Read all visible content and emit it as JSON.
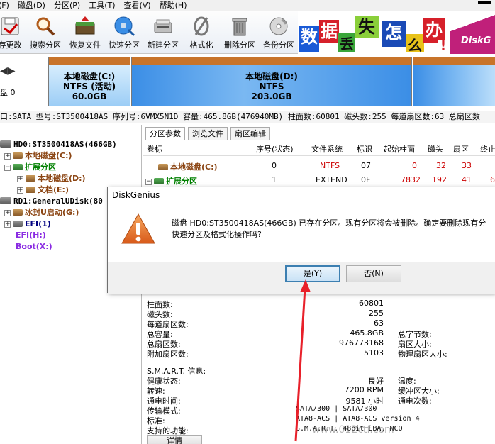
{
  "menu": {
    "items": [
      "(F)",
      "磁盘(D)",
      "分区(P)",
      "工具(T)",
      "查看(V)",
      "帮助(H)"
    ]
  },
  "toolbar": {
    "buttons": [
      {
        "label": "存更改",
        "icon": "save-icon"
      },
      {
        "label": "搜索分区",
        "icon": "magnifier-icon"
      },
      {
        "label": "恢复文件",
        "icon": "recover-files-icon"
      },
      {
        "label": "快速分区",
        "icon": "quick-partition-icon"
      },
      {
        "label": "新建分区",
        "icon": "new-partition-icon"
      },
      {
        "label": "格式化",
        "icon": "format-icon"
      },
      {
        "label": "删除分区",
        "icon": "trash-icon"
      },
      {
        "label": "备份分区",
        "icon": "backup-cd-icon"
      }
    ]
  },
  "banner": {
    "chars": [
      "数",
      "据",
      "丢",
      "失",
      "怎",
      "么",
      "办",
      "!"
    ],
    "brand": "DiskG"
  },
  "diskmap": {
    "left_label": "盘  0",
    "partitions": [
      {
        "name": "本地磁盘(C:)",
        "fs": "NTFS (活动)",
        "size": "60.0GB"
      },
      {
        "name": "本地磁盘(D:)",
        "fs": "NTFS",
        "size": "203.0GB"
      }
    ],
    "info": "口:SATA  型号:ST3500418AS  序列号:6VMX5N1D  容量:465.8GB(476940MB)  柱面数:60801  磁头数:255  每道扇区数:63  总扇区数"
  },
  "tree": {
    "nodes": [
      {
        "label": "HD0:ST3500418AS(466GB)",
        "color": "#000000"
      },
      {
        "label": "本地磁盘(C:)",
        "color": "#8b4513"
      },
      {
        "label": "扩展分区",
        "color": "#008000"
      },
      {
        "label": "本地磁盘(D:)",
        "color": "#8b4513"
      },
      {
        "label": "文档(E:)",
        "color": "#8b4513"
      },
      {
        "label": "RD1:GeneralUDisk(80",
        "color": "#000000"
      },
      {
        "label": "冰封U启动(G:)",
        "color": "#8b4513"
      },
      {
        "label": "EFI(1)",
        "color": "#000080"
      },
      {
        "label": "EFI(H:)",
        "color": "#8a2be2"
      },
      {
        "label": "Boot(X:)",
        "color": "#8a2be2"
      }
    ]
  },
  "tabs": [
    "分区参数",
    "浏览文件",
    "扇区编辑"
  ],
  "table": {
    "headers": [
      "卷标",
      "序号(状态)",
      "文件系统",
      "标识",
      "起始柱面",
      "磁头",
      "扇区",
      "终止"
    ],
    "rows": [
      {
        "name": "本地磁盘(C:)",
        "index": "0",
        "fs": "NTFS",
        "id": "07",
        "cyl": "0",
        "head": "32",
        "sec": "33",
        "end": ""
      },
      {
        "name": "扩展分区",
        "index": "1",
        "fs": "EXTEND",
        "id": "0F",
        "cyl": "7832",
        "head": "192",
        "sec": "41",
        "end": "6"
      }
    ]
  },
  "geometry_info": {
    "rows": [
      {
        "label": "柱面数:",
        "value": "60801",
        "label2": ""
      },
      {
        "label": "磁头数:",
        "value": "255",
        "label2": ""
      },
      {
        "label": "每道扇区数:",
        "value": "63",
        "label2": ""
      },
      {
        "label": "总容量:",
        "value": "465.8GB",
        "label2": "总字节数:"
      },
      {
        "label": "总扇区数:",
        "value": "976773168",
        "label2": "扇区大小:"
      },
      {
        "label": "附加扇区数:",
        "value": "5103",
        "label2": "物理扇区大小:"
      }
    ]
  },
  "smart_info": {
    "title": "S.M.A.R.T. 信息:",
    "rows": [
      {
        "label": "健康状态:",
        "value": "良好",
        "label2": "温度:"
      },
      {
        "label": "转速:",
        "value": "7200 RPM",
        "label2": "缓冲区大小:"
      },
      {
        "label": "通电时间:",
        "value": "9581 小时",
        "label2": "通电次数:"
      },
      {
        "label": "传输模式:",
        "value": "SATA/300 | SATA/300",
        "label2": ""
      },
      {
        "label": "标准:",
        "value": "ATA8-ACS | ATA8-ACS version 4",
        "label2": ""
      },
      {
        "label": "支持的功能:",
        "value": "S.M.A.R.T. 48bit LBA, NCQ",
        "label2": ""
      }
    ],
    "details_button": "详情"
  },
  "dialog": {
    "title": "DiskGenius",
    "message_line1": "磁盘 HD0:ST3500418AS(466GB) 已存在分区。现有分区将会被删除。确定要删除现有分",
    "message_line2": "快速分区及格式化操作吗?",
    "yes_button": "是(Y)",
    "no_button": "否(N)"
  },
  "watermark": "www.012ctf.com",
  "colors": {
    "accent_red": "#e8202a",
    "partition_blue": "#3b8ee6",
    "partition_cap": "#c8742a"
  }
}
